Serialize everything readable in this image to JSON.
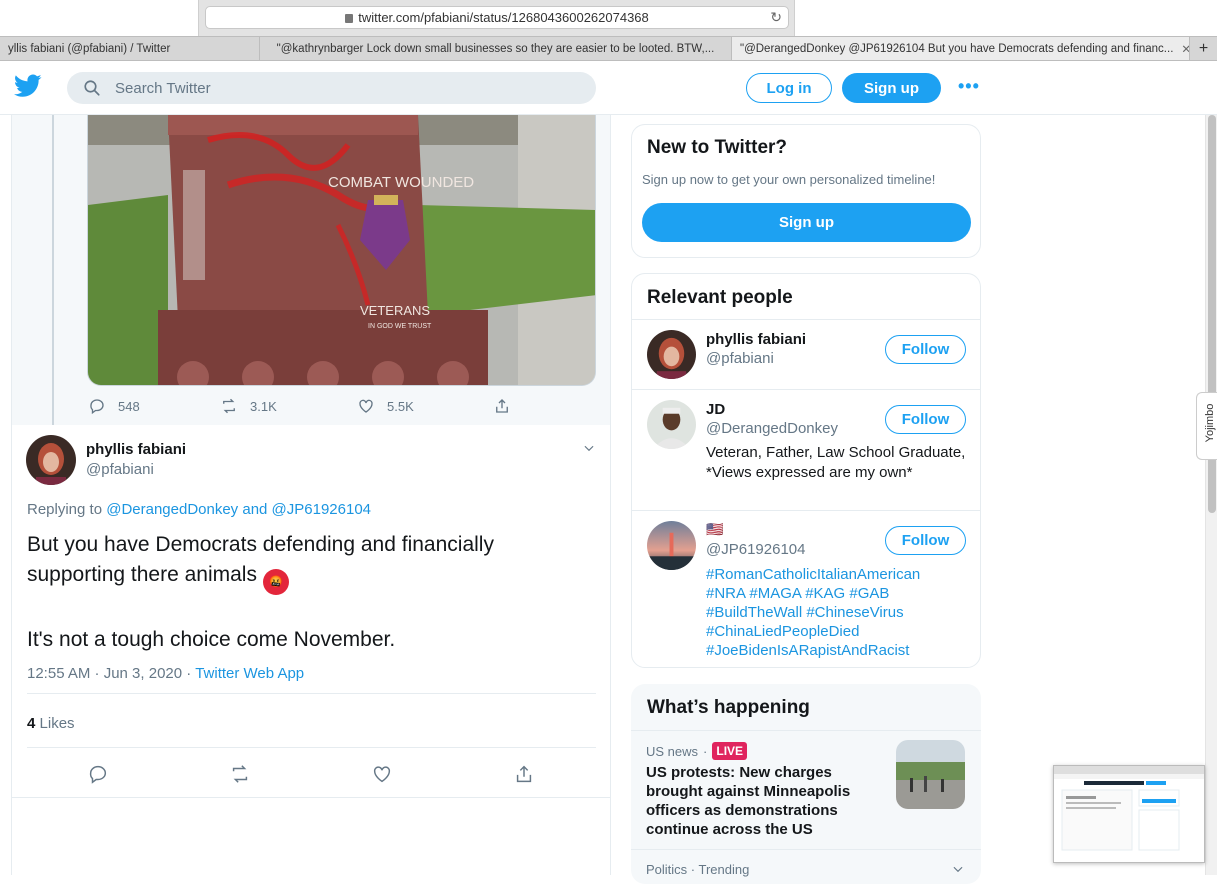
{
  "browser": {
    "url": "twitter.com/pfabiani/status/1268043600262074368",
    "tabs": [
      {
        "label": "yllis fabiani (@pfabiani) / Twitter"
      },
      {
        "label": "\"@kathrynbarger Lock down small businesses so they are easier to be looted. BTW,..."
      },
      {
        "label": "\"@DerangedDonkey @JP61926104 But you have Democrats defending and financ..."
      }
    ]
  },
  "header": {
    "search_placeholder": "Search Twitter",
    "login_label": "Log in",
    "signup_label": "Sign up",
    "more_label": "•••"
  },
  "previous_tweet": {
    "image_alt": "Vandalized Combat Wounded veterans memorial",
    "replies": "548",
    "retweets": "3.1K",
    "likes": "5.5K",
    "monument_text": {
      "heading": "COMBAT WOUNDED",
      "veterans": "VETERANS",
      "in_god": "IN GOD WE TRUST"
    }
  },
  "tweet": {
    "name": "phyllis fabiani",
    "handle": "@pfabiani",
    "replying_prefix": "Replying to",
    "replying_to": "@DerangedDonkey and @JP61926104",
    "text_line1": "But you have Democrats defending and financially",
    "text_line2": "supporting there animals",
    "emoji": "🤬",
    "text_line3": "It's not a tough choice come November.",
    "timestamp": "12:55 AM · Jun 3, 2020",
    "separator": "·",
    "source": "Twitter Web App",
    "likes_count": "4",
    "likes_label": "Likes"
  },
  "sidebar": {
    "new_title": "New to Twitter?",
    "new_subtitle": "Sign up now to get your own personalized timeline!",
    "new_signup": "Sign up",
    "people_title": "Relevant people",
    "people": [
      {
        "name": "phyllis fabiani",
        "handle": "@pfabiani",
        "follow": "Follow"
      },
      {
        "name": "JD",
        "handle": "@DerangedDonkey",
        "follow": "Follow",
        "bio": "Veteran, Father, Law School Graduate, *Views expressed are my own*"
      },
      {
        "name": "🇺🇸",
        "handle": "@JP61926104",
        "follow": "Follow",
        "tags": [
          "#RomanCatholicItalianAmerican",
          "#NRA #MAGA #KAG #GAB",
          "#BuildTheWall #ChineseVirus",
          "#ChinaLiedPeopleDied",
          "#JoeBidenIsARapistAndRacist"
        ]
      }
    ],
    "happening_title": "What’s happening",
    "news_category": "US news",
    "news_dot": "·",
    "live_label": "LIVE",
    "news_headline": "US protests: New charges brought against Minneapolis officers as demonstrations continue across the US",
    "trend_category": "Politics · Trending"
  },
  "extension": {
    "label": "Yojimbo"
  },
  "colors": {
    "twitter_blue": "#1da1f2",
    "link_blue": "#1b95e0",
    "live_red": "#e0245e",
    "gray_text": "#657786"
  },
  "icons": [
    "twitter-logo-icon",
    "search-icon",
    "reply-icon",
    "retweet-icon",
    "like-icon",
    "share-icon",
    "chevron-down-icon",
    "lock-icon",
    "reload-icon"
  ]
}
